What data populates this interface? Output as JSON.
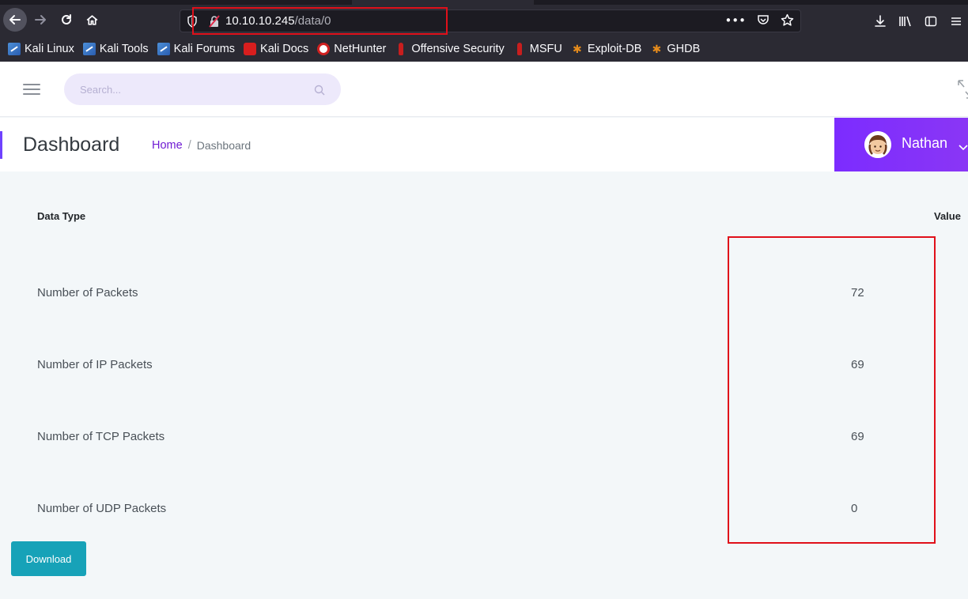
{
  "browser": {
    "url_host": "10.10.10.245",
    "url_path": "/data/0",
    "bookmarks": [
      {
        "label": "Kali Linux",
        "icon": "kali-dragon-icon"
      },
      {
        "label": "Kali Tools",
        "icon": "kali-dragon-icon"
      },
      {
        "label": "Kali Forums",
        "icon": "kali-dragon-icon"
      },
      {
        "label": "Kali Docs",
        "icon": "kali-docs-icon"
      },
      {
        "label": "NetHunter",
        "icon": "nethunter-icon"
      },
      {
        "label": "Offensive Security",
        "icon": "offsec-icon"
      },
      {
        "label": "MSFU",
        "icon": "offsec-icon"
      },
      {
        "label": "Exploit-DB",
        "icon": "exploit-db-icon"
      },
      {
        "label": "GHDB",
        "icon": "exploit-db-icon"
      }
    ]
  },
  "topbar": {
    "search_placeholder": "Search..."
  },
  "header": {
    "title": "Dashboard",
    "breadcrumb_home": "Home",
    "breadcrumb_sep": "/",
    "breadcrumb_current": "Dashboard",
    "user_name": "Nathan"
  },
  "table": {
    "col_type": "Data Type",
    "col_value": "Value",
    "rows": [
      {
        "label": "Number of Packets",
        "value": "72"
      },
      {
        "label": "Number of IP Packets",
        "value": "69"
      },
      {
        "label": "Number of TCP Packets",
        "value": "69"
      },
      {
        "label": "Number of UDP Packets",
        "value": "0"
      }
    ]
  },
  "actions": {
    "download_label": "Download"
  },
  "colors": {
    "accent_purple": "#7c2cff",
    "download_teal": "#17a2b8",
    "highlight_red": "#e0101a"
  }
}
